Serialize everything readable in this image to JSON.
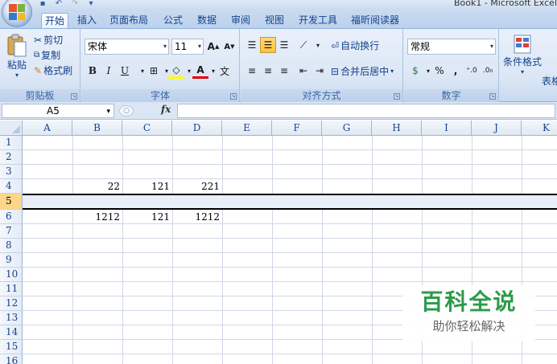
{
  "window": {
    "title": "Book1 - Microsoft Excel"
  },
  "tabs": [
    {
      "label": "开始",
      "active": true
    },
    {
      "label": "插入"
    },
    {
      "label": "页面布局"
    },
    {
      "label": "公式"
    },
    {
      "label": "数据"
    },
    {
      "label": "审阅"
    },
    {
      "label": "视图"
    },
    {
      "label": "开发工具"
    },
    {
      "label": "福昕阅读器"
    }
  ],
  "ribbon": {
    "clipboard": {
      "paste": "粘贴",
      "cut": "剪切",
      "copy": "复制",
      "format_painter": "格式刷",
      "label": "剪贴板"
    },
    "font": {
      "name": "宋体",
      "size": "11",
      "bold": "B",
      "italic": "I",
      "underline": "U",
      "label": "字体"
    },
    "alignment": {
      "wrap": "自动换行",
      "merge": "合并后居中",
      "label": "对齐方式"
    },
    "number": {
      "format": "常规",
      "percent": "%",
      "comma": ",",
      "label": "数字"
    },
    "styles": {
      "conditional": "条件格式",
      "table_partial": "表格"
    }
  },
  "formula_bar": {
    "name_box": "A5",
    "fx": "fx",
    "formula": ""
  },
  "columns": [
    "A",
    "B",
    "C",
    "D",
    "E",
    "F",
    "G",
    "H",
    "I",
    "J",
    "K"
  ],
  "rows": [
    "1",
    "2",
    "3",
    "4",
    "5",
    "6",
    "7",
    "8",
    "9",
    "10",
    "11",
    "12",
    "13",
    "14",
    "15",
    "16"
  ],
  "selected_row": "5",
  "cells": {
    "B4": "22",
    "C4": "121",
    "D4": "221",
    "B6": "1212",
    "C6": "121",
    "D6": "1212"
  },
  "watermark": {
    "title": "百科全说",
    "subtitle": "助你轻松解决"
  },
  "colors": {
    "ribbon": "#dbe6f5",
    "tab_text": "#15428b",
    "selection_row": "#ffd58a",
    "watermark_green": "#2d9b4a"
  }
}
